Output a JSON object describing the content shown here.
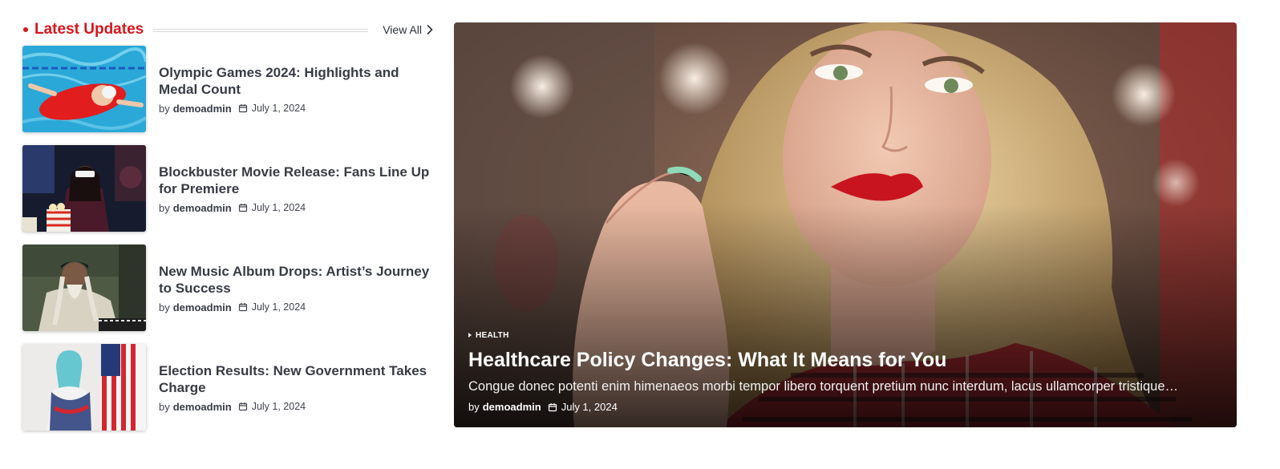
{
  "section": {
    "title": "Latest Updates",
    "view_all": "View All"
  },
  "posts": [
    {
      "title": "Olympic Games 2024: Highlights and Medal Count",
      "by": "by",
      "author": "demoadmin",
      "date": "July 1, 2024"
    },
    {
      "title": "Blockbuster Movie Release: Fans Line Up for Premiere",
      "by": "by",
      "author": "demoadmin",
      "date": "July 1, 2024"
    },
    {
      "title": "New Music Album Drops: Artist’s Journey to Success",
      "by": "by",
      "author": "demoadmin",
      "date": "July 1, 2024"
    },
    {
      "title": "Election Results: New Government Takes Charge",
      "by": "by",
      "author": "demoadmin",
      "date": "July 1, 2024"
    }
  ],
  "featured": {
    "category": "HEALTH",
    "title": "Healthcare Policy Changes: What It Means for You",
    "excerpt": "Congue donec potenti enim himenaeos morbi tempor libero torquent pretium nunc interdum, lacus ullamcorper tristique…",
    "by": "by",
    "author": "demoadmin",
    "date": "July 1, 2024"
  },
  "colors": {
    "accent": "#d8151c",
    "text": "#373b44",
    "divider": "#d9d9d9"
  },
  "icons": [
    "chevron-right-icon",
    "calendar-icon",
    "category-triangle-icon"
  ]
}
